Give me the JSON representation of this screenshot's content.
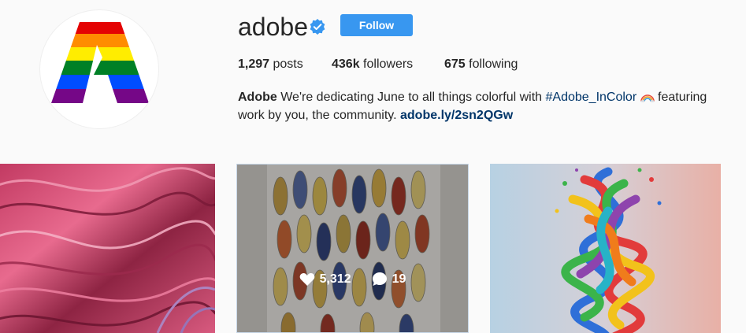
{
  "profile": {
    "username": "adobe",
    "verified_icon": "verified-badge-icon",
    "follow_label": "Follow",
    "accent_color": "#3897f0"
  },
  "stats": {
    "posts_count": "1,297",
    "posts_label": " posts",
    "followers_count": "436k",
    "followers_label": " followers",
    "following_count": "675",
    "following_label": " following"
  },
  "bio": {
    "name": "Adobe",
    "text_before": " We're dedicating June to all things colorful with ",
    "hashtag": "#Adobe_InColor",
    "text_after": " featuring work by you, the community. ",
    "link": "adobe.ly/2sn2QGw"
  },
  "posts": [
    {
      "description": "pink abstract swirl artwork"
    },
    {
      "description": "colorful leaves pattern",
      "likes": "5,312",
      "comments": "19"
    },
    {
      "description": "rainbow paint swirl sculpture"
    }
  ]
}
